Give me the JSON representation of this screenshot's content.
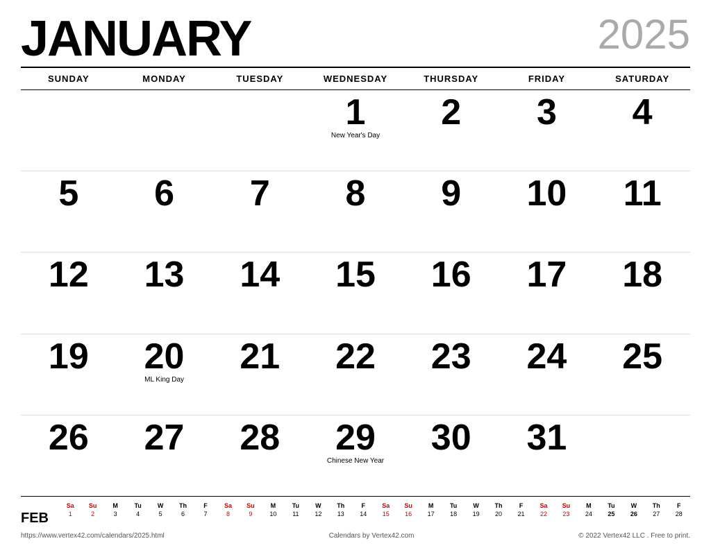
{
  "header": {
    "month": "JANUARY",
    "year": "2025"
  },
  "day_headers": [
    "SUNDAY",
    "MONDAY",
    "TUESDAY",
    "WEDNESDAY",
    "THURSDAY",
    "FRIDAY",
    "SATURDAY"
  ],
  "weeks": [
    [
      {
        "day": "",
        "holiday": ""
      },
      {
        "day": "",
        "holiday": ""
      },
      {
        "day": "",
        "holiday": ""
      },
      {
        "day": "1",
        "holiday": "New Year's Day"
      },
      {
        "day": "2",
        "holiday": ""
      },
      {
        "day": "3",
        "holiday": ""
      },
      {
        "day": "4",
        "holiday": ""
      }
    ],
    [
      {
        "day": "5",
        "holiday": ""
      },
      {
        "day": "6",
        "holiday": ""
      },
      {
        "day": "7",
        "holiday": ""
      },
      {
        "day": "8",
        "holiday": ""
      },
      {
        "day": "9",
        "holiday": ""
      },
      {
        "day": "10",
        "holiday": ""
      },
      {
        "day": "11",
        "holiday": ""
      }
    ],
    [
      {
        "day": "12",
        "holiday": ""
      },
      {
        "day": "13",
        "holiday": ""
      },
      {
        "day": "14",
        "holiday": ""
      },
      {
        "day": "15",
        "holiday": ""
      },
      {
        "day": "16",
        "holiday": ""
      },
      {
        "day": "17",
        "holiday": ""
      },
      {
        "day": "18",
        "holiday": ""
      }
    ],
    [
      {
        "day": "19",
        "holiday": ""
      },
      {
        "day": "20",
        "holiday": "ML King Day"
      },
      {
        "day": "21",
        "holiday": ""
      },
      {
        "day": "22",
        "holiday": ""
      },
      {
        "day": "23",
        "holiday": ""
      },
      {
        "day": "24",
        "holiday": ""
      },
      {
        "day": "25",
        "holiday": ""
      }
    ],
    [
      {
        "day": "26",
        "holiday": ""
      },
      {
        "day": "27",
        "holiday": ""
      },
      {
        "day": "28",
        "holiday": ""
      },
      {
        "day": "29",
        "holiday": "Chinese New Year"
      },
      {
        "day": "30",
        "holiday": ""
      },
      {
        "day": "31",
        "holiday": ""
      },
      {
        "day": "",
        "holiday": ""
      }
    ]
  ],
  "mini_calendar": {
    "month_label": "FEB",
    "col_headers": [
      "Sa",
      "Su",
      "M",
      "Tu",
      "W",
      "Th",
      "F",
      "Sa",
      "Su",
      "M",
      "Tu",
      "W",
      "Th",
      "F",
      "Sa",
      "Su",
      "M",
      "Tu",
      "W",
      "Th",
      "F",
      "Sa",
      "Su",
      "M",
      "Tu",
      "W",
      "Th",
      "F"
    ],
    "col_days": [
      "1",
      "2",
      "3",
      "4",
      "5",
      "6",
      "7",
      "8",
      "9",
      "10",
      "11",
      "12",
      "13",
      "14",
      "15",
      "16",
      "17",
      "18",
      "19",
      "20",
      "21",
      "22",
      "23",
      "24",
      "25",
      "26",
      "27",
      "28"
    ],
    "red_indices": [
      0,
      1,
      7,
      8,
      14,
      15,
      21,
      22
    ]
  },
  "footer": {
    "url": "https://www.vertex42.com/calendars/2025.html",
    "center": "Calendars by Vertex42.com",
    "right": "© 2022 Vertex42 LLC . Free to print."
  }
}
